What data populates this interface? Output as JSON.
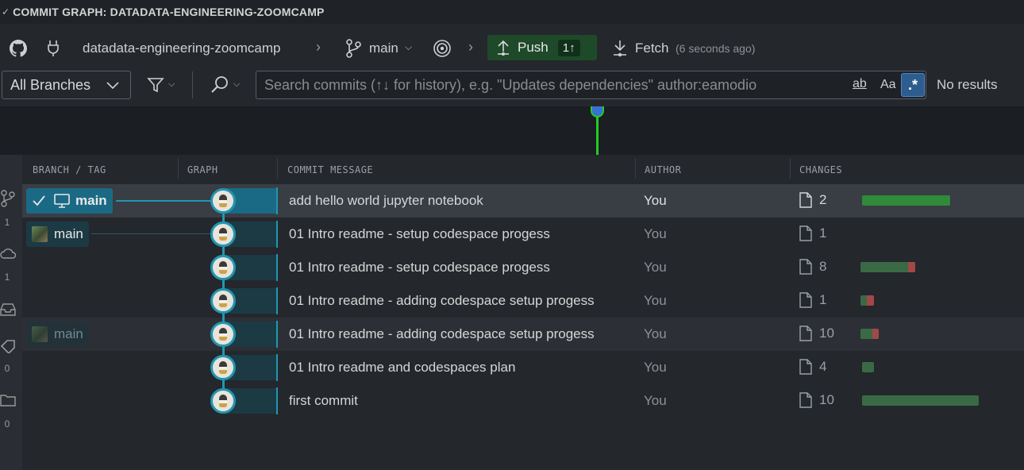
{
  "title": "COMMIT GRAPH: DATADATA-ENGINEERING-ZOOMCAMP",
  "header": {
    "repo": "datadata-engineering-zoomcamp",
    "branch": "main",
    "push_label": "Push",
    "push_count": "1↑",
    "fetch_label": "Fetch",
    "fetch_time": "(6 seconds ago)"
  },
  "toolbar": {
    "branches_select": "All Branches",
    "search_placeholder": "Search commits (↑↓ for history), e.g. \"Updates dependencies\" author:eamodio",
    "match_word": "ab",
    "match_case": "Aa",
    "regex": ".*",
    "results": "No results"
  },
  "sidebar": {
    "counts": [
      "1",
      "1",
      "0",
      "0"
    ]
  },
  "columns": [
    "BRANCH / TAG",
    "GRAPH",
    "COMMIT MESSAGE",
    "AUTHOR",
    "CHANGES"
  ],
  "commits": [
    {
      "message": "add hello world jupyter notebook",
      "author": "You",
      "files": "2",
      "branch": "main",
      "added_fraction": 1.0
    },
    {
      "message": "01 Intro readme - setup codespace progess",
      "author": "You",
      "files": "1",
      "branch": "main",
      "added_fraction": 0
    },
    {
      "message": "01 Intro readme - setup codespace progess",
      "author": "You",
      "files": "8",
      "added_fraction": 0.87
    },
    {
      "message": "01 Intro readme - adding codespace setup progess",
      "author": "You",
      "files": "1",
      "added_fraction": 0.45
    },
    {
      "message": "01 Intro readme - adding codespace setup progess",
      "author": "You",
      "files": "10",
      "branch": "main",
      "added_fraction": 0.66
    },
    {
      "message": "01 Intro readme and codespaces plan",
      "author": "You",
      "files": "4",
      "added_fraction": 1.0
    },
    {
      "message": "first commit",
      "author": "You",
      "files": "10",
      "added_fraction": 1.0
    }
  ],
  "colors": {
    "accent": "#2196b0",
    "push_bg": "#1e4a2a",
    "added": "#3a6a45",
    "deleted": "#a24848",
    "minimap_line": "#22cc22"
  }
}
